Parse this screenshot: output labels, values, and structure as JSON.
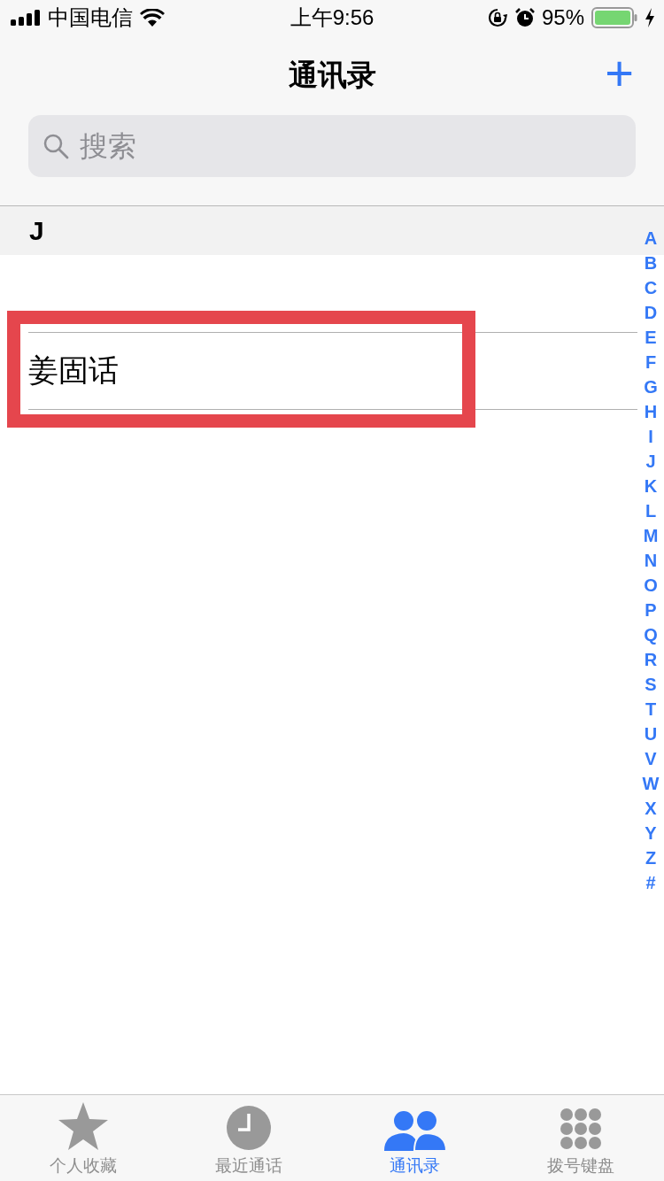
{
  "status_bar": {
    "carrier": "中国电信",
    "time": "上午9:56",
    "battery": "95%"
  },
  "nav": {
    "title": "通讯录",
    "add": "+"
  },
  "search": {
    "placeholder": "搜索"
  },
  "sections": [
    {
      "letter": "J",
      "contacts": [
        {
          "name": "姜固话",
          "highlighted": true
        }
      ]
    }
  ],
  "index": [
    "A",
    "B",
    "C",
    "D",
    "E",
    "F",
    "G",
    "H",
    "I",
    "J",
    "K",
    "L",
    "M",
    "N",
    "O",
    "P",
    "Q",
    "R",
    "S",
    "T",
    "U",
    "V",
    "W",
    "X",
    "Y",
    "Z",
    "#"
  ],
  "tabs": [
    {
      "label": "个人收藏",
      "kind": "star",
      "selected": false
    },
    {
      "label": "最近通话",
      "kind": "clock",
      "selected": false
    },
    {
      "label": "通讯录",
      "kind": "people",
      "selected": true
    },
    {
      "label": "拨号键盘",
      "kind": "keypad",
      "selected": false
    }
  ]
}
